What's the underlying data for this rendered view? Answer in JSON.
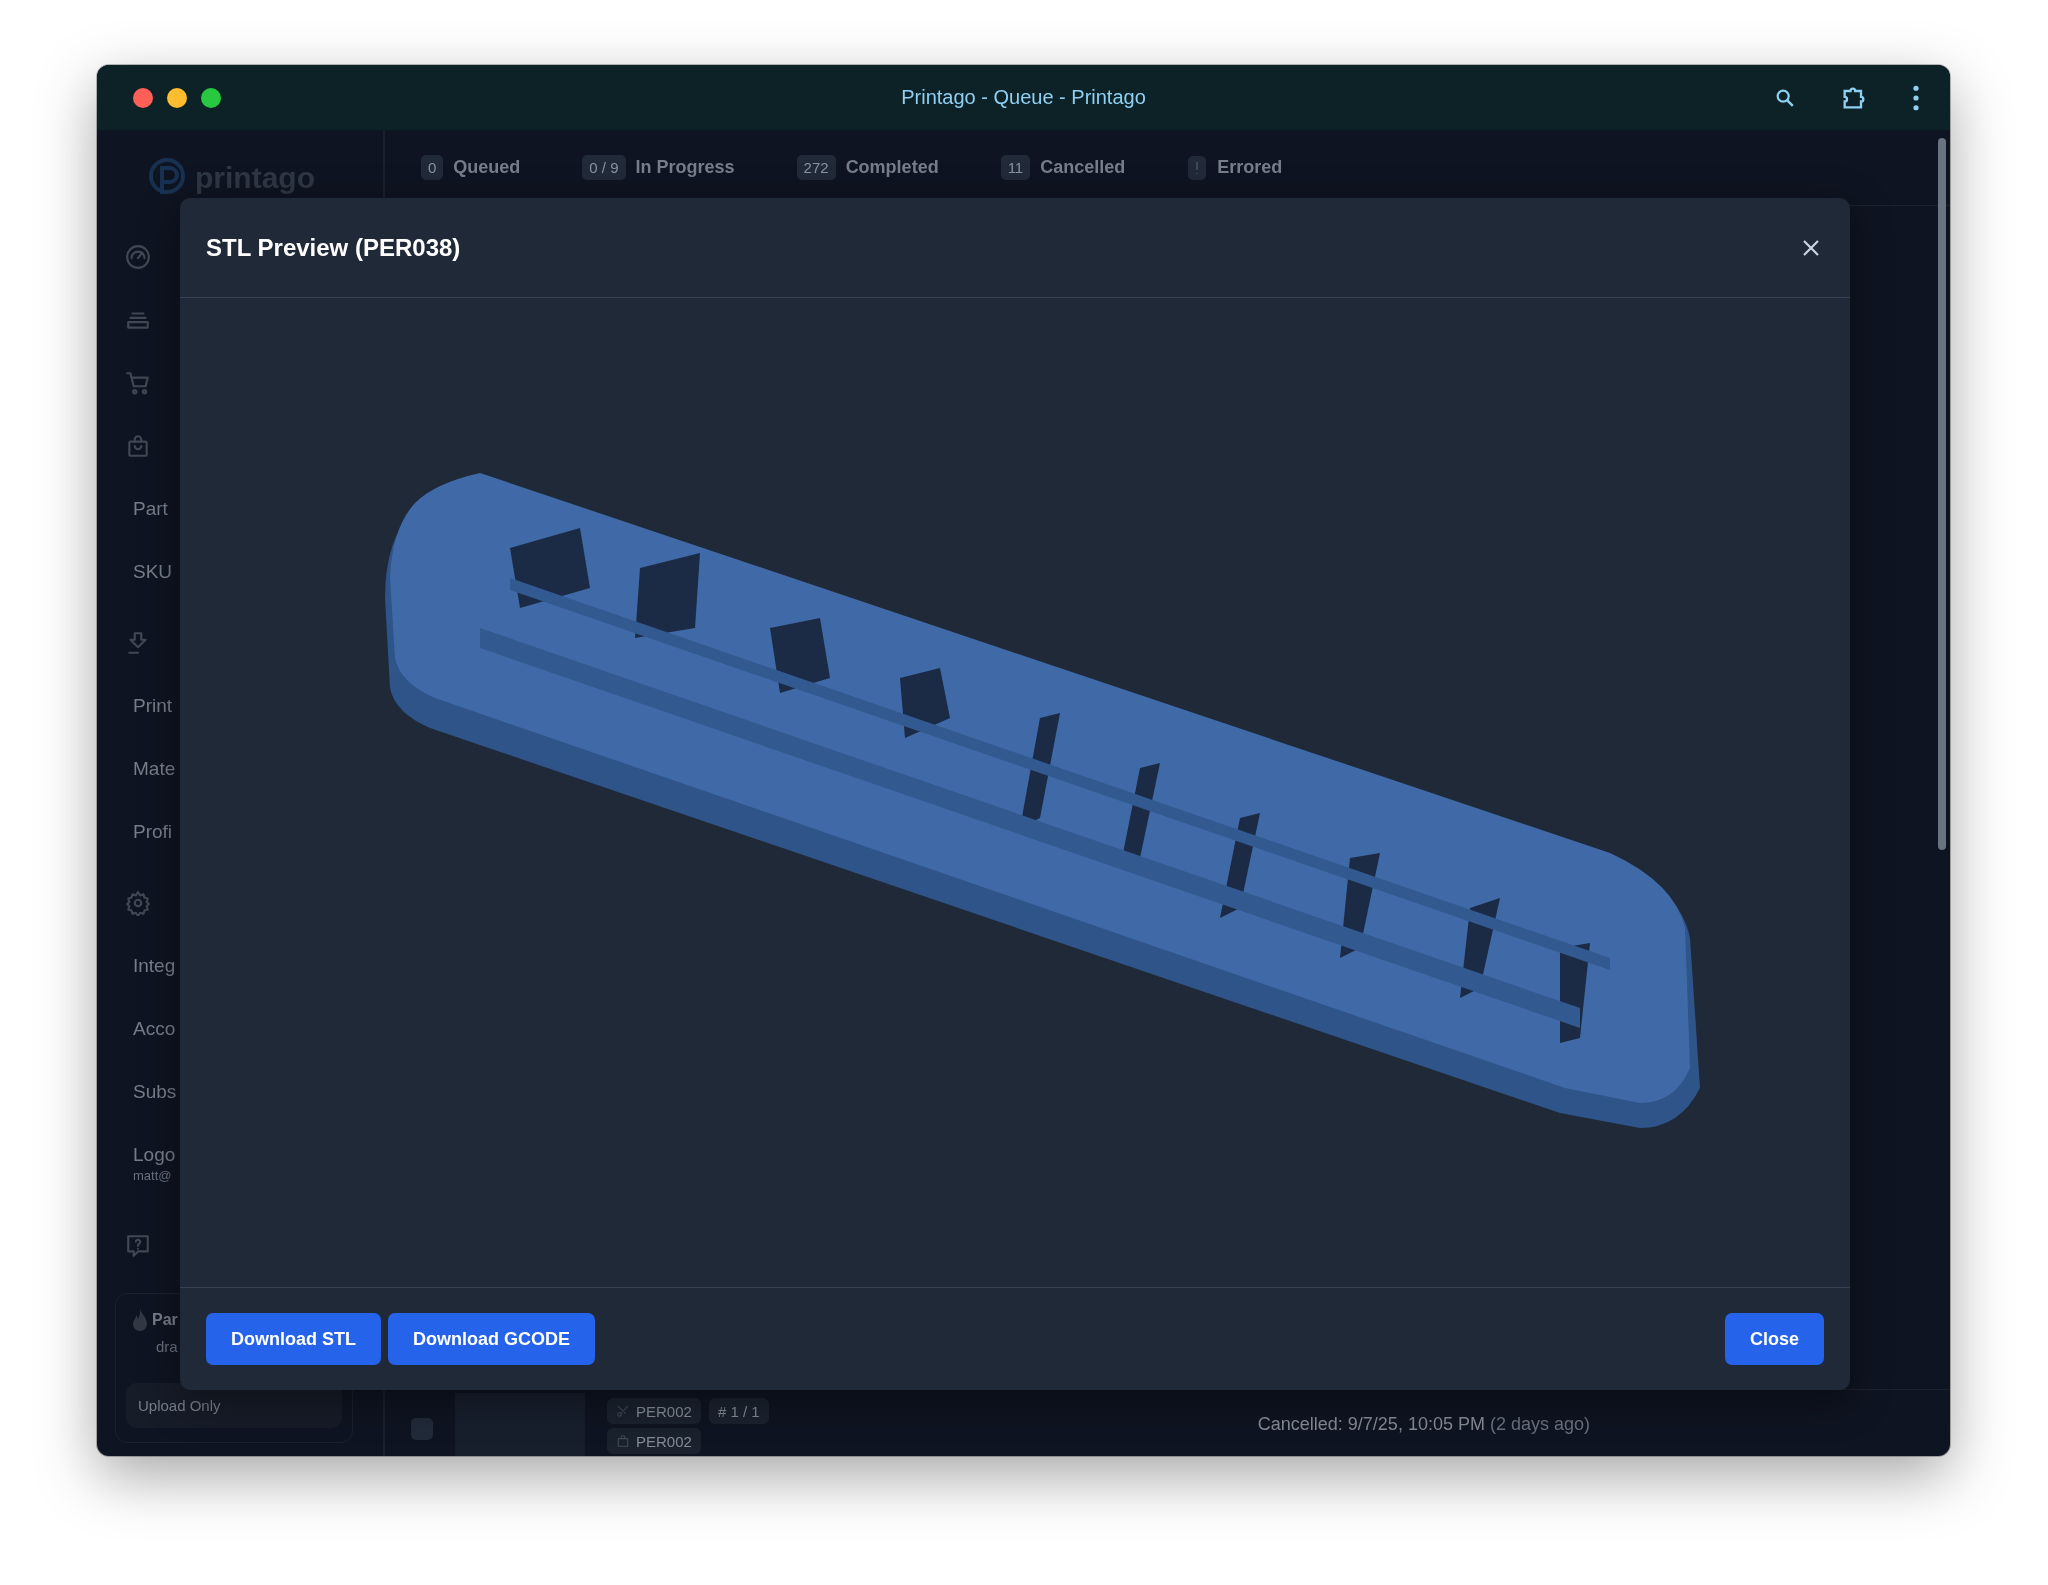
{
  "window": {
    "title": "Printago - Queue - Printago"
  },
  "sidebar": {
    "logo": "printago",
    "items": [
      {
        "kind": "section"
      },
      {
        "kind": "section"
      },
      {
        "kind": "section"
      },
      {
        "kind": "section"
      },
      {
        "kind": "sub",
        "label": "Part"
      },
      {
        "kind": "sub",
        "label": "SKU"
      },
      {
        "kind": "section"
      },
      {
        "kind": "sub",
        "label": "Print"
      },
      {
        "kind": "sub",
        "label": "Mate"
      },
      {
        "kind": "sub",
        "label": "Profi"
      },
      {
        "kind": "section"
      },
      {
        "kind": "sub",
        "label": "Integ"
      },
      {
        "kind": "sub",
        "label": "Acco"
      },
      {
        "kind": "sub",
        "label": "Subs"
      },
      {
        "kind": "sub",
        "label": "Logo",
        "note": "matt@"
      },
      {
        "kind": "section"
      }
    ],
    "plan": {
      "title": "Par",
      "subtitle": "dra",
      "mode": "Upload Only"
    }
  },
  "tabs": [
    {
      "count": "0",
      "label": "Queued"
    },
    {
      "count": "0 / 9",
      "label": "In Progress"
    },
    {
      "count": "272",
      "label": "Completed"
    },
    {
      "count": "11",
      "label": "Cancelled"
    },
    {
      "label": "Errored"
    }
  ],
  "queue_row": {
    "checked": false,
    "tags": [
      "PER002",
      "PER002"
    ],
    "copies": "# 1 / 1",
    "status": "Cancelled: 9/7/25, 10:05 PM",
    "ago": "(2 days ago)"
  },
  "modal": {
    "title": "STL Preview (PER038)",
    "buttons": [
      "Download STL",
      "Download GCODE"
    ],
    "close_button": "Close"
  }
}
